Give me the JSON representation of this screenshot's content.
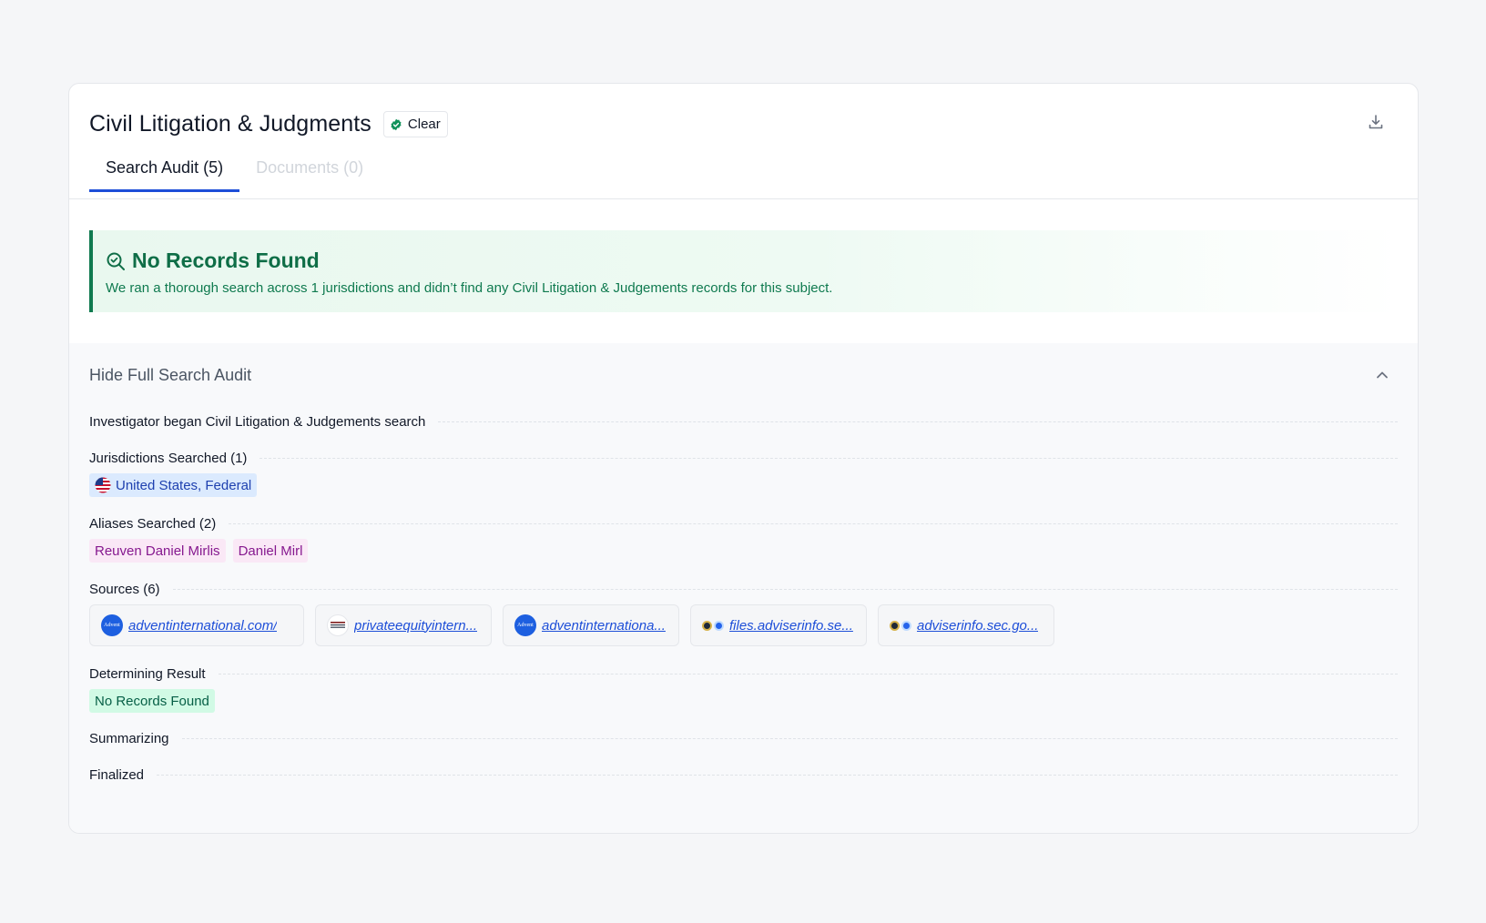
{
  "header": {
    "title": "Civil Litigation & Judgments",
    "status": "Clear"
  },
  "tabs": [
    {
      "label": "Search Audit (5)"
    },
    {
      "label": "Documents (0)"
    }
  ],
  "banner": {
    "title": "No Records Found",
    "text": "We ran a thorough search across 1 jurisdictions and didn’t find any Civil Litigation & Judgements records for this subject."
  },
  "audit": {
    "toggle_label": "Hide Full Search Audit",
    "began": "Investigator began Civil Litigation & Judgements search",
    "jurisdictions": {
      "label": "Jurisdictions Searched (1)",
      "items": [
        "United States, Federal"
      ]
    },
    "aliases": {
      "label": "Aliases Searched (2)",
      "items": [
        "Reuven Daniel Mirlis",
        "Daniel Mirl"
      ]
    },
    "sources": {
      "label": "Sources (6)",
      "items": [
        {
          "text": "adventinternational.com/",
          "icon": "advent-logo-icon"
        },
        {
          "text": "privateequityintern...",
          "icon": "pei-logo-icon"
        },
        {
          "text": "adventinternationa...",
          "icon": "advent-logo-icon"
        },
        {
          "text": "files.adviserinfo.se...",
          "icon": "sec-logo-icon"
        },
        {
          "text": "adviserinfo.sec.go...",
          "icon": "sec-logo-icon"
        }
      ]
    },
    "result": {
      "label": "Determining Result",
      "value": "No Records Found"
    },
    "summarizing": "Summarizing",
    "finalized": "Finalized"
  },
  "icon_text": {
    "advent": "Advent"
  },
  "colors": {
    "accent": "#1d4ed8",
    "success": "#0f7a4f",
    "alias": "#86198f"
  }
}
